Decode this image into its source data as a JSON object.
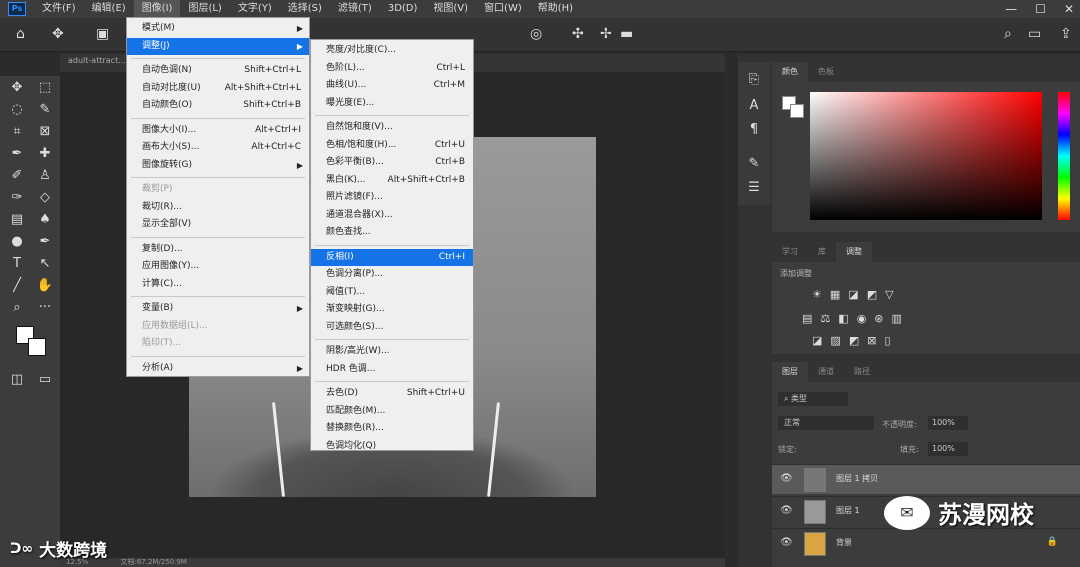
{
  "app": {
    "logo": "Ps"
  },
  "menubar": {
    "items": [
      "文件(F)",
      "编辑(E)",
      "图像(I)",
      "图层(L)",
      "文字(Y)",
      "选择(S)",
      "滤镜(T)",
      "3D(D)",
      "视图(V)",
      "窗口(W)",
      "帮助(H)"
    ],
    "active_index": 2
  },
  "document": {
    "tab_title": "adult-attract...",
    "zoom": "12.5%",
    "doc_info": "文档:67.2M/250.9M"
  },
  "image_menu": {
    "items": [
      {
        "label": "模式(M)",
        "submenu": true
      },
      {
        "label": "调整(J)",
        "submenu": true,
        "highlight": true
      },
      {
        "label": "自动色调(N)",
        "shortcut": "Shift+Ctrl+L"
      },
      {
        "label": "自动对比度(U)",
        "shortcut": "Alt+Shift+Ctrl+L"
      },
      {
        "label": "自动颜色(O)",
        "shortcut": "Shift+Ctrl+B"
      },
      {
        "label": "图像大小(I)...",
        "shortcut": "Alt+Ctrl+I"
      },
      {
        "label": "画布大小(S)...",
        "shortcut": "Alt+Ctrl+C"
      },
      {
        "label": "图像旋转(G)",
        "submenu": true
      },
      {
        "label": "裁剪(P)",
        "disabled": true
      },
      {
        "label": "裁切(R)..."
      },
      {
        "label": "显示全部(V)"
      },
      {
        "label": "复制(D)..."
      },
      {
        "label": "应用图像(Y)..."
      },
      {
        "label": "计算(C)..."
      },
      {
        "label": "变量(B)",
        "submenu": true
      },
      {
        "label": "应用数据组(L)...",
        "disabled": true
      },
      {
        "label": "陷印(T)...",
        "disabled": true
      },
      {
        "label": "分析(A)",
        "submenu": true
      }
    ]
  },
  "adjust_menu": {
    "items": [
      {
        "label": "亮度/对比度(C)..."
      },
      {
        "label": "色阶(L)...",
        "shortcut": "Ctrl+L"
      },
      {
        "label": "曲线(U)...",
        "shortcut": "Ctrl+M"
      },
      {
        "label": "曝光度(E)..."
      },
      {
        "label": "自然饱和度(V)..."
      },
      {
        "label": "色相/饱和度(H)...",
        "shortcut": "Ctrl+U"
      },
      {
        "label": "色彩平衡(B)...",
        "shortcut": "Ctrl+B"
      },
      {
        "label": "黑白(K)...",
        "shortcut": "Alt+Shift+Ctrl+B"
      },
      {
        "label": "照片滤镜(F)..."
      },
      {
        "label": "通道混合器(X)..."
      },
      {
        "label": "颜色查找..."
      },
      {
        "label": "反相(I)",
        "shortcut": "Ctrl+I",
        "highlight": true
      },
      {
        "label": "色调分离(P)..."
      },
      {
        "label": "阈值(T)..."
      },
      {
        "label": "渐变映射(G)..."
      },
      {
        "label": "可选颜色(S)..."
      },
      {
        "label": "阴影/高光(W)..."
      },
      {
        "label": "HDR 色调..."
      },
      {
        "label": "去色(D)",
        "shortcut": "Shift+Ctrl+U"
      },
      {
        "label": "匹配颜色(M)..."
      },
      {
        "label": "替换颜色(R)..."
      },
      {
        "label": "色调均化(Q)"
      }
    ]
  },
  "color_panel": {
    "tabs": [
      "颜色",
      "色板"
    ]
  },
  "adjust_panel": {
    "tabs": [
      "学习",
      "库",
      "调整"
    ],
    "title": "添加调整"
  },
  "layers_panel": {
    "tabs": [
      "图层",
      "通道",
      "路径"
    ],
    "filter": "类型",
    "blend_mode": "正常",
    "opacity_label": "不透明度:",
    "opacity": "100%",
    "lock_label": "锁定:",
    "fill_label": "填充:",
    "fill": "100%",
    "layers": [
      {
        "name": "图层 1 拷贝"
      },
      {
        "name": "图层 1"
      },
      {
        "name": "背景"
      }
    ]
  },
  "watermarks": {
    "brand": "苏漫网校",
    "source": "大数跨境"
  },
  "colors": {
    "accent": "#1473e6",
    "menu_bg": "#efefef",
    "panel_bg": "#3c3c3c"
  }
}
